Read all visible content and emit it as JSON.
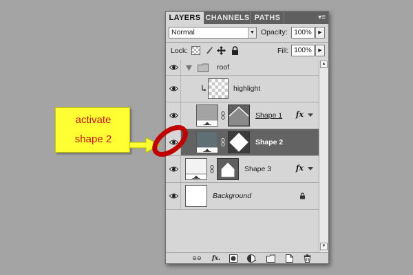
{
  "panel": {
    "tabs": [
      {
        "label": "LAYERS",
        "active": true
      },
      {
        "label": "CHANNELS",
        "active": false
      },
      {
        "label": "PATHS",
        "active": false
      }
    ],
    "menu_glyph": "▾≡",
    "blend_mode": "Normal",
    "opacity_label": "Opacity:",
    "opacity_value": "100%",
    "lock_label": "Lock:",
    "fill_label": "Fill:",
    "fill_value": "100%"
  },
  "layers": [
    {
      "name": "roof",
      "type": "group",
      "visible": true,
      "expanded": true
    },
    {
      "name": "highlight",
      "type": "clipped",
      "visible": false
    },
    {
      "name": "Shape 1",
      "type": "shape",
      "fx": "fx",
      "visible": true
    },
    {
      "name": "Shape 2",
      "type": "shape",
      "selected": true,
      "visible": true
    },
    {
      "name": "Shape 3",
      "type": "shape",
      "fx": "fx",
      "visible": true
    },
    {
      "name": "Background",
      "type": "background",
      "locked": true,
      "visible": true
    }
  ],
  "bottom_icons": [
    "link-icon",
    "fx-icon",
    "mask-icon",
    "adjustment-icon",
    "folder-icon",
    "new-layer-icon",
    "trash-icon"
  ],
  "bottom_labels": {
    "link": "⊖⊖",
    "fx": "fx."
  },
  "annotation": {
    "line1": "activate",
    "line2": "shape 2",
    "colors": {
      "callout_bg": "#ffff33",
      "text": "#c4151a",
      "circle": "#c00000"
    }
  },
  "colors": {
    "selected_row": "#636363",
    "panel_bg": "#d6d6d6",
    "background": "#a4a4a4"
  }
}
